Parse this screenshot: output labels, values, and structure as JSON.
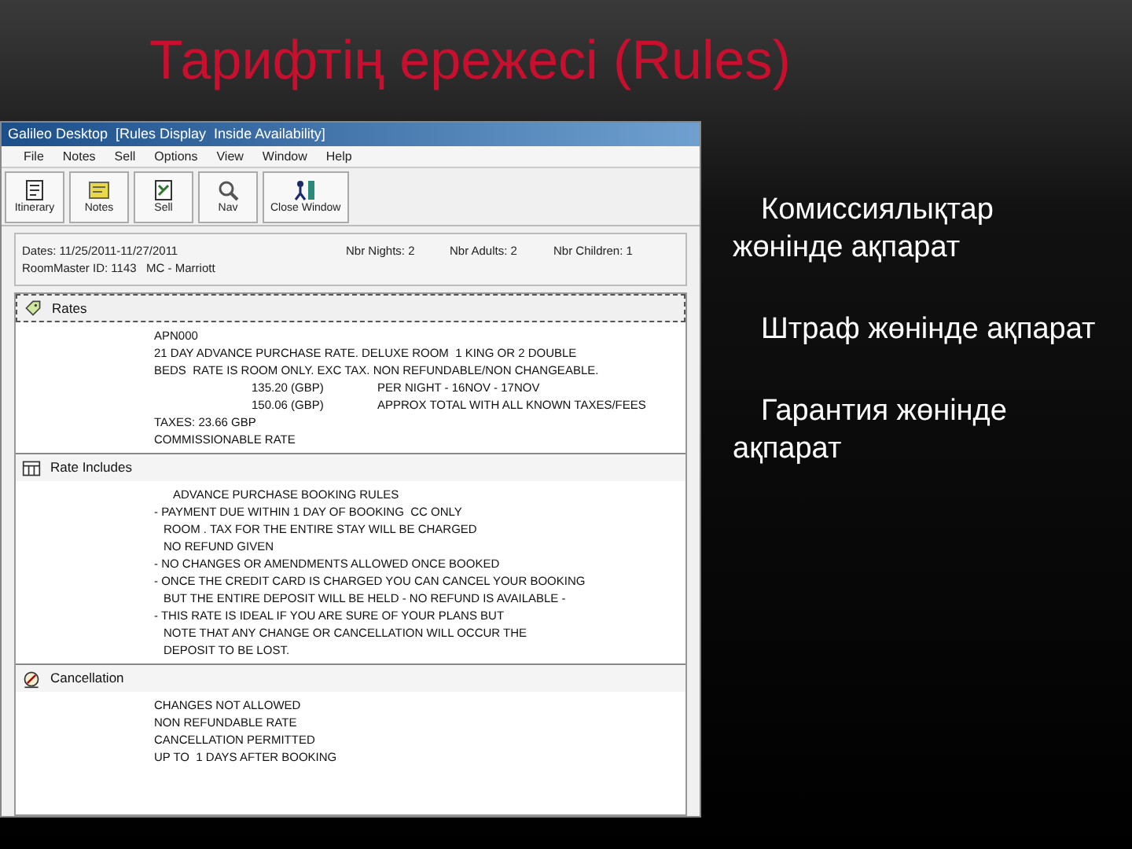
{
  "slide": {
    "title": "Тарифтің ережесі (Rules)",
    "bullets": [
      "Комиссиялықтар жөнінде ақпарат",
      "Штраф жөнінде ақпарат",
      "Гарантия жөнінде ақпарат"
    ]
  },
  "app": {
    "window_title": "Galileo Desktop  [Rules Display  Inside Availability]",
    "menu": [
      "File",
      "Notes",
      "Sell",
      "Options",
      "View",
      "Window",
      "Help"
    ],
    "toolbar": [
      {
        "label": "Itinerary",
        "kind": "itinerary"
      },
      {
        "label": "Notes",
        "kind": "notes"
      },
      {
        "label": "Sell",
        "kind": "sell"
      },
      {
        "label": "Nav",
        "kind": "nav"
      },
      {
        "label": "Close Window",
        "kind": "close"
      }
    ],
    "header": {
      "dates": "Dates: 11/25/2011-11/27/2011",
      "property": "RoomMaster ID: 1143   MC - Marriott",
      "nights": "Nbr Nights: 2",
      "adults": "Nbr Adults: 2",
      "children": "Nbr Children: 1"
    },
    "sections": [
      {
        "title": "Rates",
        "kind": "rates",
        "lines": [
          {
            "kind": "plain",
            "text": "APN000"
          },
          {
            "kind": "plain",
            "text": "21 DAY ADVANCE PURCHASE RATE. DELUXE ROOM  1 KING OR 2 DOUBLE"
          },
          {
            "kind": "plain",
            "text": "BEDS  RATE IS ROOM ONLY. EXC TAX. NON REFUNDABLE/NON CHANGEABLE."
          },
          {
            "kind": "pair",
            "amount": "135.20 (GBP)",
            "note": "PER NIGHT - 16NOV - 17NOV"
          },
          {
            "kind": "pair",
            "amount": "150.06 (GBP)",
            "note": "APPROX TOTAL WITH ALL KNOWN TAXES/FEES"
          },
          {
            "kind": "plain",
            "text": "TAXES: 23.66 GBP"
          },
          {
            "kind": "plain",
            "text": "COMMISSIONABLE RATE"
          }
        ]
      },
      {
        "title": "Rate Includes",
        "kind": "includes",
        "lines": [
          {
            "kind": "heading",
            "text": "ADVANCE PURCHASE BOOKING RULES"
          },
          {
            "kind": "item",
            "text": "- PAYMENT DUE WITHIN 1 DAY OF BOOKING  CC ONLY"
          },
          {
            "kind": "cont",
            "text": "ROOM . TAX FOR THE ENTIRE STAY WILL BE CHARGED"
          },
          {
            "kind": "cont",
            "text": "NO REFUND GIVEN"
          },
          {
            "kind": "item",
            "text": "- NO CHANGES OR AMENDMENTS ALLOWED ONCE BOOKED"
          },
          {
            "kind": "item",
            "text": "- ONCE THE CREDIT CARD IS CHARGED YOU CAN CANCEL YOUR BOOKING"
          },
          {
            "kind": "cont",
            "text": "BUT THE ENTIRE DEPOSIT WILL BE HELD - NO REFUND IS AVAILABLE -"
          },
          {
            "kind": "item",
            "text": "- THIS RATE IS IDEAL IF YOU ARE SURE OF YOUR PLANS BUT"
          },
          {
            "kind": "cont",
            "text": "NOTE THAT ANY CHANGE OR CANCELLATION WILL OCCUR THE"
          },
          {
            "kind": "cont",
            "text": "DEPOSIT TO BE LOST."
          }
        ]
      },
      {
        "title": "Cancellation",
        "kind": "cancel",
        "lines": [
          {
            "kind": "plain",
            "text": "CHANGES NOT ALLOWED"
          },
          {
            "kind": "plain",
            "text": "NON REFUNDABLE RATE"
          },
          {
            "kind": "plain",
            "text": "CANCELLATION PERMITTED"
          },
          {
            "kind": "plain",
            "text": "UP TO  1 DAYS AFTER BOOKING"
          }
        ]
      }
    ]
  }
}
